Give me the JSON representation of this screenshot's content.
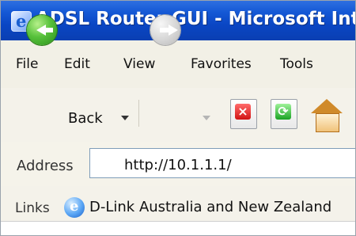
{
  "window": {
    "title": "ADSL Router GUI - Microsoft Inte",
    "app_icon": "internet-explorer-icon"
  },
  "menu": {
    "items": [
      {
        "label": "File"
      },
      {
        "label": "Edit"
      },
      {
        "label": "View"
      },
      {
        "label": "Favorites"
      },
      {
        "label": "Tools"
      }
    ]
  },
  "toolbar": {
    "back_label": "Back",
    "icons": [
      "back-icon",
      "forward-icon",
      "stop-icon",
      "refresh-icon",
      "home-icon"
    ]
  },
  "address": {
    "label": "Address",
    "value": "http://10.1.1.1/"
  },
  "links": {
    "label": "Links",
    "items": [
      {
        "label": "D-Link Australia and New Zealand",
        "icon": "internet-explorer-icon"
      }
    ]
  }
}
